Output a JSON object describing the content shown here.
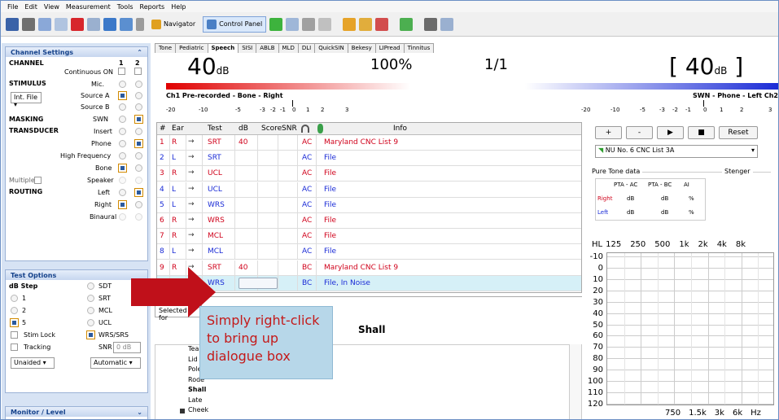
{
  "menu": [
    "File",
    "Edit",
    "View",
    "Measurement",
    "Tools",
    "Reports",
    "Help"
  ],
  "toolbar": {
    "navigator": "Navigator",
    "control_panel": "Control Panel"
  },
  "sidebar": {
    "channel_settings": "Channel Settings",
    "channel": "CHANNEL",
    "ch1": "1",
    "ch2": "2",
    "continuous_on": "Continuous ON",
    "stimulus": "STIMULUS",
    "mic": "Mic.",
    "source_a": "Source A",
    "source_b": "Source B",
    "int_file": "Int. File",
    "masking": "MASKING",
    "swn": "SWN",
    "transducer": "TRANSDUCER",
    "insert": "Insert",
    "phone": "Phone",
    "high_frequency": "High Frequency",
    "bone": "Bone",
    "multiple": "Multiple",
    "speaker": "Speaker",
    "routing": "ROUTING",
    "left": "Left",
    "right": "Right",
    "binaural": "Binaural",
    "test_options": "Test Options",
    "db_step": "dB Step",
    "sdt": "SDT",
    "step_1": "1",
    "srt": "SRT",
    "step_2": "2",
    "mcl": "MCL",
    "step_5": "5",
    "ucl": "UCL",
    "stim_lock": "Stim Lock",
    "wrs_srs": "WRS/SRS",
    "tracking": "Tracking",
    "snr": "SNR",
    "snr_val": "0 dB",
    "unaided": "Unaided",
    "automatic": "Automatic",
    "monitor_level": "Monitor / Level"
  },
  "tabs": [
    "Tone",
    "Pediatric",
    "Speech",
    "SISI",
    "ABLB",
    "MLD",
    "DLI",
    "QuickSIN",
    "Bekesy",
    "LIPread",
    "Tinnitus"
  ],
  "display": {
    "left_db": "40",
    "db_unit": "dB",
    "percent": "100%",
    "fraction": "1/1",
    "right_bracket_open": "[",
    "right_db": "40",
    "right_bracket_close": "]",
    "ch1_label": "Ch1  Pre-recorded - Bone - Right",
    "ch2_label": "SWN - Phone - Left  Ch2"
  },
  "scale_left": [
    "-20",
    "-10",
    "-5",
    "-3",
    "-2",
    "-1",
    "0",
    "1",
    "2",
    "3"
  ],
  "scale_right": [
    "-20",
    "-10",
    "-5",
    "-3",
    "-2",
    "-1",
    "0",
    "1",
    "2",
    "3"
  ],
  "table": {
    "headers": [
      "#",
      "Ear",
      "",
      "Test",
      "dB",
      "Score",
      "SNR",
      "",
      "",
      "Info"
    ],
    "rows": [
      {
        "n": "1",
        "ear": "R",
        "test": "SRT",
        "db": "40",
        "tr": "AC",
        "info": "Maryland CNC List 9"
      },
      {
        "n": "2",
        "ear": "L",
        "test": "SRT",
        "db": "",
        "tr": "AC",
        "info": "File"
      },
      {
        "n": "3",
        "ear": "R",
        "test": "UCL",
        "db": "",
        "tr": "AC",
        "info": "File"
      },
      {
        "n": "4",
        "ear": "L",
        "test": "UCL",
        "db": "",
        "tr": "AC",
        "info": "File"
      },
      {
        "n": "5",
        "ear": "L",
        "test": "WRS",
        "db": "",
        "tr": "AC",
        "info": "File"
      },
      {
        "n": "6",
        "ear": "R",
        "test": "WRS",
        "db": "",
        "tr": "AC",
        "info": "File"
      },
      {
        "n": "7",
        "ear": "R",
        "test": "MCL",
        "db": "",
        "tr": "AC",
        "info": "File"
      },
      {
        "n": "8",
        "ear": "L",
        "test": "MCL",
        "db": "",
        "tr": "AC",
        "info": "File"
      },
      {
        "n": "9",
        "ear": "R",
        "test": "SRT",
        "db": "40",
        "tr": "BC",
        "info": "Maryland CNC List 9"
      },
      {
        "n": "",
        "ear": "",
        "test": "WRS",
        "db": "",
        "tr": "BC",
        "info": "File, In Noise"
      }
    ]
  },
  "word_panel": {
    "tab": "Selected for",
    "title": "Shall",
    "words": [
      "Team",
      "Lid",
      "Pole",
      "Rode",
      "Shall",
      "Late",
      "Cheek"
    ]
  },
  "callout": "Simply right-click to bring up dialogue box",
  "right_panel": {
    "plus": "+",
    "minus": "-",
    "reset": "Reset",
    "list_select": "NU No. 6 CNC List 3A",
    "pure_tone": "Pure Tone data",
    "stenger": "Stenger",
    "pta_ac": "PTA - AC",
    "pta_bc": "PTA - BC",
    "ai": "AI",
    "right": "Right",
    "left": "Left",
    "db": "dB",
    "pct": "%"
  },
  "audiogram": {
    "hl": "HL",
    "freqs_top": [
      "125",
      "250",
      "500",
      "1k",
      "2k",
      "4k",
      "8k"
    ],
    "levels": [
      "-10",
      "0",
      "10",
      "20",
      "30",
      "40",
      "50",
      "60",
      "70",
      "80",
      "90",
      "100",
      "110",
      "120"
    ],
    "freqs_bottom": [
      "750",
      "1.5k",
      "3k",
      "6k",
      "Hz"
    ]
  },
  "colors": {
    "red": "#d0021b",
    "blue": "#1a2bd6",
    "accent": "#d18a00"
  }
}
